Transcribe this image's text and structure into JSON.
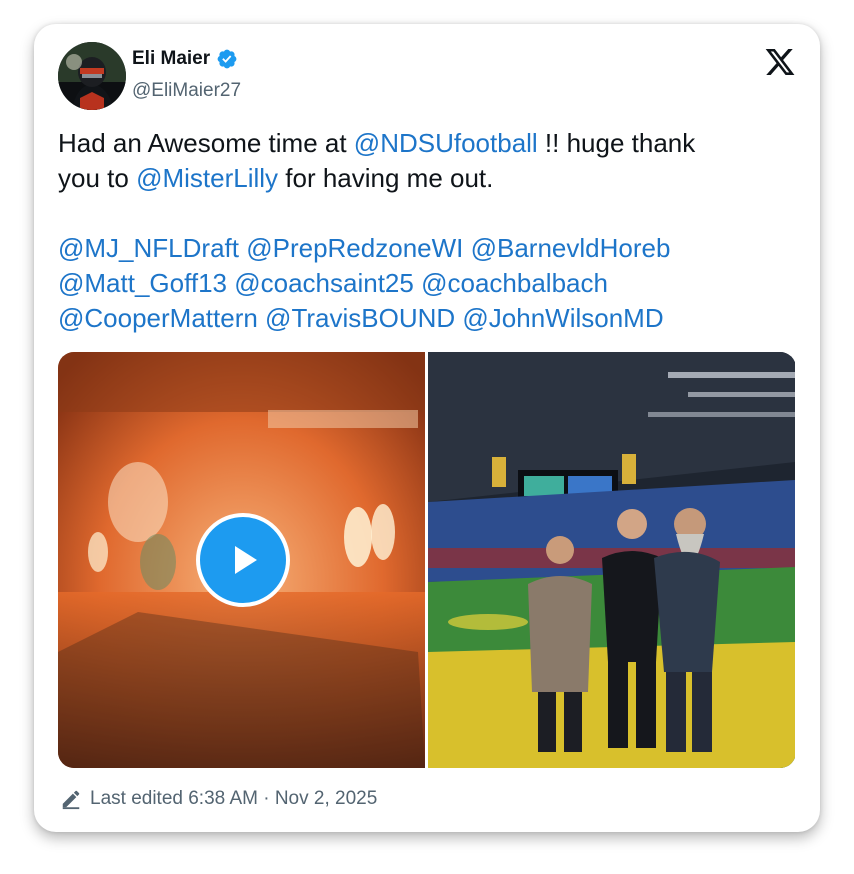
{
  "author": {
    "name": "Eli Maier",
    "handle": "@EliMaier27",
    "verified": true
  },
  "tweet": {
    "line1_pre": "Had an Awesome time at ",
    "mention_ndsu": "@NDSUfootball",
    "line1_post": " !! huge thank",
    "line2_pre": "you to ",
    "mention_misterlilly": "@MisterLilly",
    "line2_post": " for having me out.",
    "mentions": [
      [
        "@MJ_NFLDraft",
        "@PrepRedzoneWI",
        "@BarnevldHoreb"
      ],
      [
        "@Matt_Goff13",
        "@coachsaint25",
        "@coachbalbach"
      ],
      [
        "@CooperMattern",
        "@TravisBOUND",
        "@JohnWilsonMD"
      ]
    ]
  },
  "footer": {
    "edited": "Last edited 6:38 AM · Nov 2, 2025"
  },
  "icons": {
    "verified": "verified-badge-icon",
    "logo": "x-logo-icon",
    "play": "play-icon",
    "edit": "pencil-icon"
  },
  "colors": {
    "mention": "#1d75c9",
    "verified": "#1d9bf0",
    "text": "#0f1419",
    "secondary": "#536471"
  }
}
